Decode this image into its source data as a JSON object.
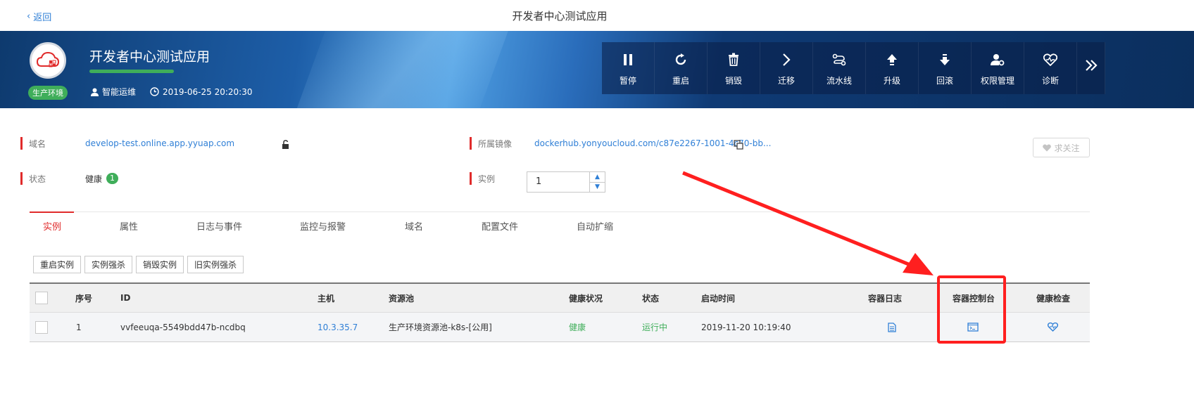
{
  "topbar": {
    "back_label": "返回",
    "title": "开发者中心测试应用"
  },
  "app": {
    "name": "开发者中心测试应用",
    "env_badge": "生产环境",
    "owner": "智能运维",
    "created_at": "2019-06-25 20:20:30",
    "progress_fraction": 0.4
  },
  "actions": [
    {
      "label": "暂停",
      "icon": "pause-icon"
    },
    {
      "label": "重启",
      "icon": "restart-icon"
    },
    {
      "label": "销毁",
      "icon": "trash-icon"
    },
    {
      "label": "迁移",
      "icon": "chevron-right-icon"
    },
    {
      "label": "流水线",
      "icon": "pipeline-icon"
    },
    {
      "label": "升级",
      "icon": "upgrade-icon"
    },
    {
      "label": "回滚",
      "icon": "rollback-icon"
    },
    {
      "label": "权限管理",
      "icon": "user-settings-icon"
    },
    {
      "label": "诊断",
      "icon": "heart-pulse-icon"
    }
  ],
  "info": {
    "domain_label": "域名",
    "domain_value": "develop-test.online.app.yyuap.com",
    "image_label": "所属镜像",
    "image_value": "dockerhub.yonyoucloud.com/c87e2267-1001-4c70-bb...",
    "status_label": "状态",
    "status_value": "健康",
    "status_count": "1",
    "instance_label": "实例",
    "instance_value": "1",
    "follow_label": "求关注"
  },
  "tabs": [
    "实例",
    "属性",
    "日志与事件",
    "监控与报警",
    "域名",
    "配置文件",
    "自动扩缩"
  ],
  "buttons": [
    "重启实例",
    "实例强杀",
    "销毁实例",
    "旧实例强杀"
  ],
  "table": {
    "headers": {
      "index": "序号",
      "id": "ID",
      "host": "主机",
      "pool": "资源池",
      "health": "健康状况",
      "state": "状态",
      "start": "启动时间",
      "log": "容器日志",
      "console": "容器控制台",
      "check": "健康检查"
    },
    "rows": [
      {
        "index": "1",
        "id": "vvfeeuqa-5549bdd47b-ncdbq",
        "host": "10.3.35.7",
        "pool": "生产环境资源池-k8s-[公用]",
        "health": "健康",
        "state": "运行中",
        "start": "2019-11-20 10:19:40"
      }
    ]
  },
  "colors": {
    "accent_red": "#e02b2b",
    "link_blue": "#2f7fd6",
    "ok_green": "#3fae5a",
    "annotation_red": "#ff1f1f"
  }
}
